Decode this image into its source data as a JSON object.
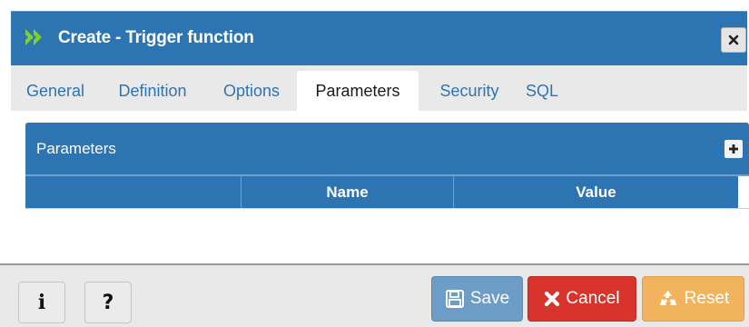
{
  "dialog": {
    "title": "Create - Trigger function",
    "title_icon": "double-chevron-right-icon",
    "close_label": "×"
  },
  "tabs": [
    {
      "label": "General"
    },
    {
      "label": "Definition"
    },
    {
      "label": "Options"
    },
    {
      "label": "Parameters",
      "active": true
    },
    {
      "label": "Security"
    },
    {
      "label": "SQL"
    }
  ],
  "parameters_panel": {
    "title": "Parameters",
    "add_icon": "plus-icon",
    "columns": [
      "",
      "Name",
      "Value"
    ],
    "rows": []
  },
  "footer": {
    "info_label": "i",
    "help_label": "?",
    "save_label": "Save",
    "cancel_label": "Cancel",
    "reset_label": "Reset"
  },
  "colors": {
    "primary": "#2d74b3",
    "cancel": "#d9342b",
    "reset": "#f2b35f",
    "save_disabled": "#6d9cc6"
  }
}
